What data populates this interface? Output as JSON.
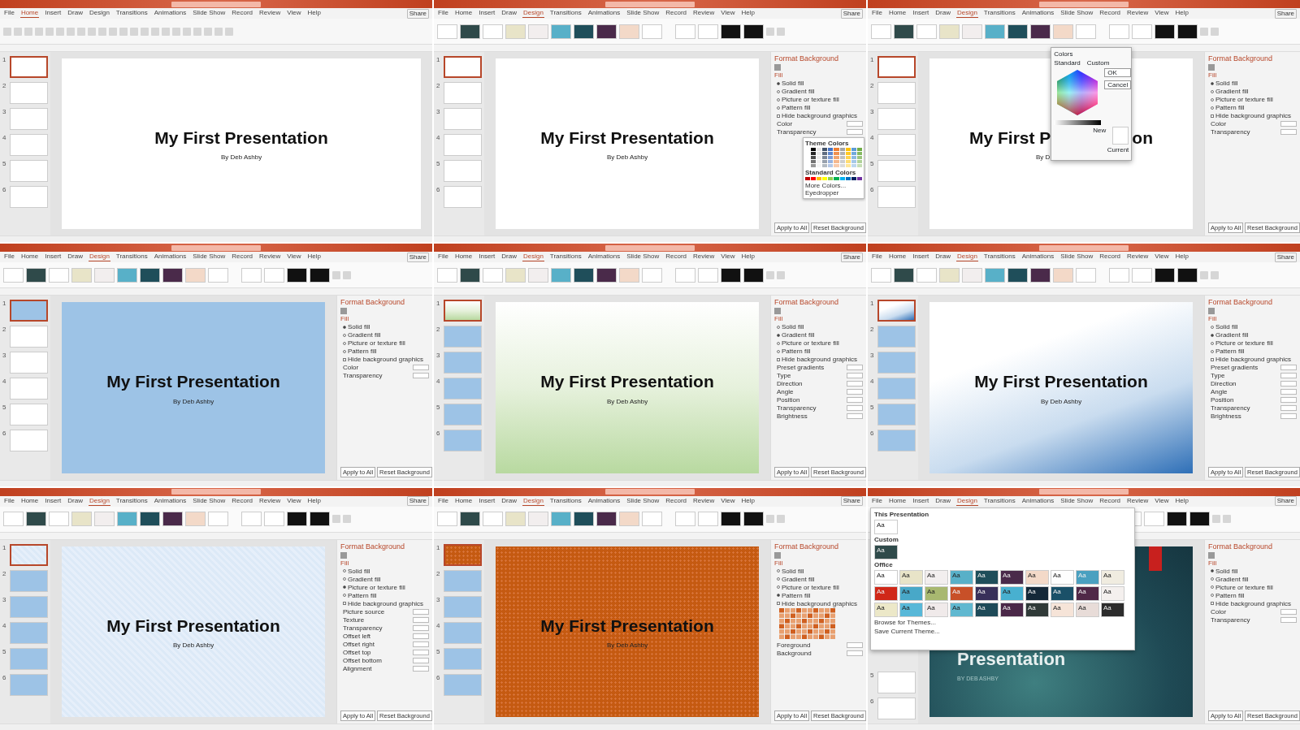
{
  "panels": [
    {
      "tabs": [
        {
          "label": "File",
          "selected": false
        },
        {
          "label": "Home",
          "selected": true
        },
        {
          "label": "Insert",
          "selected": false
        },
        {
          "label": "Draw",
          "selected": false
        },
        {
          "label": "Design",
          "selected": false
        },
        {
          "label": "Transitions",
          "selected": false
        },
        {
          "label": "Animations",
          "selected": false
        },
        {
          "label": "Slide Show",
          "selected": false
        },
        {
          "label": "Record",
          "selected": false
        },
        {
          "label": "Review",
          "selected": false
        },
        {
          "label": "View",
          "selected": false
        },
        {
          "label": "Help",
          "selected": false
        }
      ],
      "share": "Share",
      "ribbon": {
        "kind": "home"
      },
      "thumbs": [
        {
          "number": "1",
          "kind": "plain",
          "selected": true
        },
        {
          "number": "2",
          "kind": "plain",
          "selected": false
        },
        {
          "number": "3",
          "kind": "plain",
          "selected": false
        },
        {
          "number": "4",
          "kind": "plain",
          "selected": false
        },
        {
          "number": "5",
          "kind": "plain",
          "selected": false
        },
        {
          "number": "6",
          "kind": "plain",
          "selected": false
        }
      ],
      "slide": {
        "kind": "plain",
        "title": "My First Presentation",
        "subtitle": "By Deb Ashby"
      }
    },
    {
      "tabs": [
        {
          "label": "File",
          "selected": false
        },
        {
          "label": "Home",
          "selected": false
        },
        {
          "label": "Insert",
          "selected": false
        },
        {
          "label": "Draw",
          "selected": false
        },
        {
          "label": "Design",
          "selected": true
        },
        {
          "label": "Transitions",
          "selected": false
        },
        {
          "label": "Animations",
          "selected": false
        },
        {
          "label": "Slide Show",
          "selected": false
        },
        {
          "label": "Record",
          "selected": false
        },
        {
          "label": "Review",
          "selected": false
        },
        {
          "label": "View",
          "selected": false
        },
        {
          "label": "Help",
          "selected": false
        }
      ],
      "share": "Share",
      "ribbon": {
        "kind": "design"
      },
      "thumbs": [
        {
          "number": "1",
          "kind": "plain",
          "selected": true
        },
        {
          "number": "2",
          "kind": "plain",
          "selected": false
        },
        {
          "number": "3",
          "kind": "plain",
          "selected": false
        },
        {
          "number": "4",
          "kind": "plain",
          "selected": false
        },
        {
          "number": "5",
          "kind": "plain",
          "selected": false
        },
        {
          "number": "6",
          "kind": "plain",
          "selected": false
        }
      ],
      "slide": {
        "kind": "plain",
        "title": "My First Presentation",
        "subtitle": "By Deb Ashby"
      },
      "pane": {
        "title": "Format Background",
        "section": "Fill",
        "options": [
          {
            "label": "Solid fill",
            "selected": true
          },
          {
            "label": "Gradient fill",
            "selected": false
          },
          {
            "label": "Picture or texture fill",
            "selected": false
          },
          {
            "label": "Pattern fill",
            "selected": false
          }
        ],
        "hide_graphics": {
          "label": "Hide background graphics",
          "checked": false
        },
        "rows": [
          "Color",
          "Transparency"
        ],
        "buttons": [
          "Apply to All",
          "Reset Background"
        ]
      },
      "color_menu": {
        "sections": [
          "Theme Colors",
          "Standard Colors"
        ],
        "items": [
          "More Colors...",
          "Eyedropper"
        ]
      }
    },
    {
      "tabs": [
        {
          "label": "File",
          "selected": false
        },
        {
          "label": "Home",
          "selected": false
        },
        {
          "label": "Insert",
          "selected": false
        },
        {
          "label": "Draw",
          "selected": false
        },
        {
          "label": "Design",
          "selected": true
        },
        {
          "label": "Transitions",
          "selected": false
        },
        {
          "label": "Animations",
          "selected": false
        },
        {
          "label": "Slide Show",
          "selected": false
        },
        {
          "label": "Record",
          "selected": false
        },
        {
          "label": "Review",
          "selected": false
        },
        {
          "label": "View",
          "selected": false
        },
        {
          "label": "Help",
          "selected": false
        }
      ],
      "share": "Share",
      "ribbon": {
        "kind": "design"
      },
      "thumbs": [
        {
          "number": "1",
          "kind": "plain",
          "selected": true
        },
        {
          "number": "2",
          "kind": "plain",
          "selected": false
        },
        {
          "number": "3",
          "kind": "plain",
          "selected": false
        },
        {
          "number": "4",
          "kind": "plain",
          "selected": false
        },
        {
          "number": "5",
          "kind": "plain",
          "selected": false
        },
        {
          "number": "6",
          "kind": "plain",
          "selected": false
        }
      ],
      "slide": {
        "kind": "plain",
        "title_parts": [
          "My First P",
          "on"
        ],
        "subtitle": "By D"
      },
      "pane": {
        "title": "Format Background",
        "section": "Fill",
        "options": [
          {
            "label": "Solid fill",
            "selected": true
          },
          {
            "label": "Gradient fill",
            "selected": false
          },
          {
            "label": "Picture or texture fill",
            "selected": false
          },
          {
            "label": "Pattern fill",
            "selected": false
          }
        ],
        "hide_graphics": {
          "label": "Hide background graphics",
          "checked": false
        },
        "rows": [
          "Color",
          "Transparency"
        ],
        "buttons": [
          "Apply to All",
          "Reset Background"
        ]
      },
      "colors_dialog": {
        "title": "Colors",
        "tabs": [
          "Standard",
          "Custom"
        ],
        "buttons": [
          "OK",
          "Cancel"
        ],
        "new_label": "New",
        "current_label": "Current"
      }
    },
    {
      "tabs": [
        {
          "label": "File",
          "selected": false
        },
        {
          "label": "Home",
          "selected": false
        },
        {
          "label": "Insert",
          "selected": false
        },
        {
          "label": "Draw",
          "selected": false
        },
        {
          "label": "Design",
          "selected": true
        },
        {
          "label": "Transitions",
          "selected": false
        },
        {
          "label": "Animations",
          "selected": false
        },
        {
          "label": "Slide Show",
          "selected": false
        },
        {
          "label": "Record",
          "selected": false
        },
        {
          "label": "Review",
          "selected": false
        },
        {
          "label": "View",
          "selected": false
        },
        {
          "label": "Help",
          "selected": false
        }
      ],
      "share": "Share",
      "ribbon": {
        "kind": "design"
      },
      "thumbs": [
        {
          "number": "1",
          "kind": "blue",
          "selected": true
        },
        {
          "number": "2",
          "kind": "plain",
          "selected": false
        },
        {
          "number": "3",
          "kind": "plain",
          "selected": false
        },
        {
          "number": "4",
          "kind": "plain",
          "selected": false
        },
        {
          "number": "5",
          "kind": "plain",
          "selected": false
        },
        {
          "number": "6",
          "kind": "plain",
          "selected": false
        }
      ],
      "slide": {
        "kind": "blue",
        "title": "My First Presentation",
        "subtitle": "By Deb Ashby"
      },
      "pane": {
        "title": "Format Background",
        "section": "Fill",
        "options": [
          {
            "label": "Solid fill",
            "selected": true
          },
          {
            "label": "Gradient fill",
            "selected": false
          },
          {
            "label": "Picture or texture fill",
            "selected": false
          },
          {
            "label": "Pattern fill",
            "selected": false
          }
        ],
        "hide_graphics": {
          "label": "Hide background graphics",
          "checked": false
        },
        "rows": [
          "Color",
          "Transparency"
        ],
        "buttons": [
          "Apply to All",
          "Reset Background"
        ]
      }
    },
    {
      "tabs": [
        {
          "label": "File",
          "selected": false
        },
        {
          "label": "Home",
          "selected": false
        },
        {
          "label": "Insert",
          "selected": false
        },
        {
          "label": "Draw",
          "selected": false
        },
        {
          "label": "Design",
          "selected": true
        },
        {
          "label": "Transitions",
          "selected": false
        },
        {
          "label": "Animations",
          "selected": false
        },
        {
          "label": "Slide Show",
          "selected": false
        },
        {
          "label": "Record",
          "selected": false
        },
        {
          "label": "Review",
          "selected": false
        },
        {
          "label": "View",
          "selected": false
        },
        {
          "label": "Help",
          "selected": false
        }
      ],
      "share": "Share",
      "ribbon": {
        "kind": "design"
      },
      "thumbs": [
        {
          "number": "1",
          "kind": "green-gradient",
          "selected": true
        },
        {
          "number": "2",
          "kind": "blue",
          "selected": false
        },
        {
          "number": "3",
          "kind": "blue",
          "selected": false
        },
        {
          "number": "4",
          "kind": "blue",
          "selected": false
        },
        {
          "number": "5",
          "kind": "blue",
          "selected": false
        },
        {
          "number": "6",
          "kind": "blue",
          "selected": false
        }
      ],
      "slide": {
        "kind": "green-gradient",
        "title": "My First Presentation",
        "subtitle": "By Deb Ashby"
      },
      "pane": {
        "title": "Format Background",
        "section": "Fill",
        "options": [
          {
            "label": "Solid fill",
            "selected": false
          },
          {
            "label": "Gradient fill",
            "selected": true
          },
          {
            "label": "Picture or texture fill",
            "selected": false
          },
          {
            "label": "Pattern fill",
            "selected": false
          }
        ],
        "hide_graphics": {
          "label": "Hide background graphics",
          "checked": false
        },
        "rows": [
          "Preset gradients",
          "Type",
          "Direction",
          "Angle",
          "Position",
          "Transparency",
          "Brightness"
        ],
        "buttons": [
          "Apply to All",
          "Reset Background"
        ]
      }
    },
    {
      "tabs": [
        {
          "label": "File",
          "selected": false
        },
        {
          "label": "Home",
          "selected": false
        },
        {
          "label": "Insert",
          "selected": false
        },
        {
          "label": "Draw",
          "selected": false
        },
        {
          "label": "Design",
          "selected": true
        },
        {
          "label": "Transitions",
          "selected": false
        },
        {
          "label": "Animations",
          "selected": false
        },
        {
          "label": "Slide Show",
          "selected": false
        },
        {
          "label": "Record",
          "selected": false
        },
        {
          "label": "Review",
          "selected": false
        },
        {
          "label": "View",
          "selected": false
        },
        {
          "label": "Help",
          "selected": false
        }
      ],
      "share": "Share",
      "ribbon": {
        "kind": "design"
      },
      "thumbs": [
        {
          "number": "1",
          "kind": "blue-gradient",
          "selected": true
        },
        {
          "number": "2",
          "kind": "blue",
          "selected": false
        },
        {
          "number": "3",
          "kind": "blue",
          "selected": false
        },
        {
          "number": "4",
          "kind": "blue",
          "selected": false
        },
        {
          "number": "5",
          "kind": "blue",
          "selected": false
        },
        {
          "number": "6",
          "kind": "blue",
          "selected": false
        }
      ],
      "slide": {
        "kind": "blue-gradient",
        "title": "My First Presentation",
        "subtitle": "By Deb Ashby"
      },
      "pane": {
        "title": "Format Background",
        "section": "Fill",
        "options": [
          {
            "label": "Solid fill",
            "selected": false
          },
          {
            "label": "Gradient fill",
            "selected": true
          },
          {
            "label": "Picture or texture fill",
            "selected": false
          },
          {
            "label": "Pattern fill",
            "selected": false
          }
        ],
        "hide_graphics": {
          "label": "Hide background graphics",
          "checked": false
        },
        "rows": [
          "Preset gradients",
          "Type",
          "Direction",
          "Angle",
          "Position",
          "Transparency",
          "Brightness"
        ],
        "buttons": [
          "Apply to All",
          "Reset Background"
        ]
      }
    },
    {
      "tabs": [
        {
          "label": "File",
          "selected": false
        },
        {
          "label": "Home",
          "selected": false
        },
        {
          "label": "Insert",
          "selected": false
        },
        {
          "label": "Draw",
          "selected": false
        },
        {
          "label": "Design",
          "selected": true
        },
        {
          "label": "Transitions",
          "selected": false
        },
        {
          "label": "Animations",
          "selected": false
        },
        {
          "label": "Slide Show",
          "selected": false
        },
        {
          "label": "Record",
          "selected": false
        },
        {
          "label": "Review",
          "selected": false
        },
        {
          "label": "View",
          "selected": false
        },
        {
          "label": "Help",
          "selected": false
        }
      ],
      "share": "Share",
      "ribbon": {
        "kind": "design"
      },
      "thumbs": [
        {
          "number": "1",
          "kind": "blue-texture",
          "selected": true
        },
        {
          "number": "2",
          "kind": "blue",
          "selected": false
        },
        {
          "number": "3",
          "kind": "blue",
          "selected": false
        },
        {
          "number": "4",
          "kind": "blue",
          "selected": false
        },
        {
          "number": "5",
          "kind": "blue",
          "selected": false
        },
        {
          "number": "6",
          "kind": "blue",
          "selected": false
        }
      ],
      "slide": {
        "kind": "blue-texture",
        "title": "My First Presentation",
        "subtitle": "By Deb Ashby"
      },
      "pane": {
        "title": "Format Background",
        "section": "Fill",
        "options": [
          {
            "label": "Solid fill",
            "selected": false
          },
          {
            "label": "Gradient fill",
            "selected": false
          },
          {
            "label": "Picture or texture fill",
            "selected": true
          },
          {
            "label": "Pattern fill",
            "selected": false
          }
        ],
        "hide_graphics": {
          "label": "Hide background graphics",
          "checked": false
        },
        "rows": [
          "Picture source",
          "Texture",
          "Transparency",
          "Offset left",
          "Offset right",
          "Offset top",
          "Offset bottom",
          "Alignment"
        ],
        "buttons": [
          "Apply to All",
          "Reset Background"
        ]
      }
    },
    {
      "tabs": [
        {
          "label": "File",
          "selected": false
        },
        {
          "label": "Home",
          "selected": false
        },
        {
          "label": "Insert",
          "selected": false
        },
        {
          "label": "Draw",
          "selected": false
        },
        {
          "label": "Design",
          "selected": true
        },
        {
          "label": "Transitions",
          "selected": false
        },
        {
          "label": "Animations",
          "selected": false
        },
        {
          "label": "Slide Show",
          "selected": false
        },
        {
          "label": "Record",
          "selected": false
        },
        {
          "label": "Review",
          "selected": false
        },
        {
          "label": "View",
          "selected": false
        },
        {
          "label": "Help",
          "selected": false
        }
      ],
      "share": "Share",
      "ribbon": {
        "kind": "design"
      },
      "thumbs": [
        {
          "number": "1",
          "kind": "orange-pattern",
          "selected": true
        },
        {
          "number": "2",
          "kind": "blue",
          "selected": false
        },
        {
          "number": "3",
          "kind": "blue",
          "selected": false
        },
        {
          "number": "4",
          "kind": "blue",
          "selected": false
        },
        {
          "number": "5",
          "kind": "blue",
          "selected": false
        },
        {
          "number": "6",
          "kind": "blue",
          "selected": false
        }
      ],
      "slide": {
        "kind": "orange-pattern",
        "title": "My First Presentation",
        "subtitle": "By Deb Ashby"
      },
      "pane": {
        "title": "Format Background",
        "section": "Fill",
        "options": [
          {
            "label": "Solid fill",
            "selected": false
          },
          {
            "label": "Gradient fill",
            "selected": false
          },
          {
            "label": "Picture or texture fill",
            "selected": false
          },
          {
            "label": "Pattern fill",
            "selected": true
          }
        ],
        "hide_graphics": {
          "label": "Hide background graphics",
          "checked": false
        },
        "pattern_grid": true,
        "rows": [
          "Foreground",
          "Background"
        ],
        "buttons": [
          "Apply to All",
          "Reset Background"
        ]
      }
    },
    {
      "tabs": [
        {
          "label": "File",
          "selected": false
        },
        {
          "label": "Home",
          "selected": false
        },
        {
          "label": "Insert",
          "selected": false
        },
        {
          "label": "Draw",
          "selected": false
        },
        {
          "label": "Design",
          "selected": true
        },
        {
          "label": "Transitions",
          "selected": false
        },
        {
          "label": "Animations",
          "selected": false
        },
        {
          "label": "Slide Show",
          "selected": false
        },
        {
          "label": "Record",
          "selected": false
        },
        {
          "label": "Review",
          "selected": false
        },
        {
          "label": "View",
          "selected": false
        },
        {
          "label": "Help",
          "selected": false
        }
      ],
      "share": "Share",
      "ribbon": {
        "kind": "design"
      },
      "thumbs": [
        {
          "number": "5",
          "kind": "plain",
          "selected": false
        },
        {
          "number": "6",
          "kind": "plain",
          "selected": false
        }
      ],
      "slide": {
        "kind": "teal-theme",
        "title": "Presentation",
        "subtitle": "BY DEB ASHBY"
      },
      "pane": {
        "title": "Format Background",
        "section": "Fill",
        "options": [
          {
            "label": "Solid fill",
            "selected": true
          },
          {
            "label": "Gradient fill",
            "selected": false
          },
          {
            "label": "Picture or texture fill",
            "selected": false
          },
          {
            "label": "Pattern fill",
            "selected": false
          }
        ],
        "hide_graphics": {
          "label": "Hide background graphics",
          "checked": false
        },
        "rows": [
          "Color",
          "Transparency"
        ],
        "buttons": [
          "Apply to All",
          "Reset Background"
        ]
      },
      "theme_gallery": {
        "sections": [
          "This Presentation",
          "Custom",
          "Office"
        ],
        "current": [
          {
            "label": "Aa",
            "color": "#ffffff"
          }
        ],
        "custom": [
          {
            "label": "Aa",
            "color": "#2f4a4a"
          }
        ],
        "office": [
          {
            "label": "Aa",
            "color": "#ffffff"
          },
          {
            "label": "Aa",
            "color": "#e8e4c8"
          },
          {
            "label": "Aa",
            "color": "#f2eeee"
          },
          {
            "label": "Aa",
            "color": "#58b0c8"
          },
          {
            "label": "Aa",
            "color": "#1f4e5a"
          },
          {
            "label": "Aa",
            "color": "#4a2a4a"
          },
          {
            "label": "Aa",
            "color": "#f3d9c8"
          },
          {
            "label": "Aa",
            "color": "#fefefe"
          },
          {
            "label": "Aa",
            "color": "#4aa0c0"
          },
          {
            "label": "Aa",
            "color": "#f0ece0"
          },
          {
            "label": "Aa",
            "color": "#d02818"
          },
          {
            "label": "Aa",
            "color": "#48a8c8"
          },
          {
            "label": "Aa",
            "color": "#a8b870"
          },
          {
            "label": "Aa",
            "color": "#c85028"
          },
          {
            "label": "Aa",
            "color": "#38305a"
          },
          {
            "label": "Aa",
            "color": "#48b0d0"
          },
          {
            "label": "Aa",
            "color": "#142838"
          },
          {
            "label": "Aa",
            "color": "#1a5068"
          },
          {
            "label": "Aa",
            "color": "#502848"
          },
          {
            "label": "Aa",
            "color": "#f4f0ee"
          },
          {
            "label": "Aa",
            "color": "#ece8c8"
          },
          {
            "label": "Aa",
            "color": "#58b8d8"
          },
          {
            "label": "Aa",
            "color": "#f0eaea"
          },
          {
            "label": "Aa",
            "color": "#60b8d0"
          },
          {
            "label": "Aa",
            "color": "#1e4a58"
          },
          {
            "label": "Aa",
            "color": "#4a2848"
          },
          {
            "label": "Aa",
            "color": "#303a38"
          },
          {
            "label": "Aa",
            "color": "#f6e4d8"
          },
          {
            "label": "Aa",
            "color": "#e8dcd8"
          },
          {
            "label": "Aa",
            "color": "#2c2c2c"
          }
        ],
        "items": [
          "Browse for Themes...",
          "Save Current Theme..."
        ]
      }
    }
  ]
}
